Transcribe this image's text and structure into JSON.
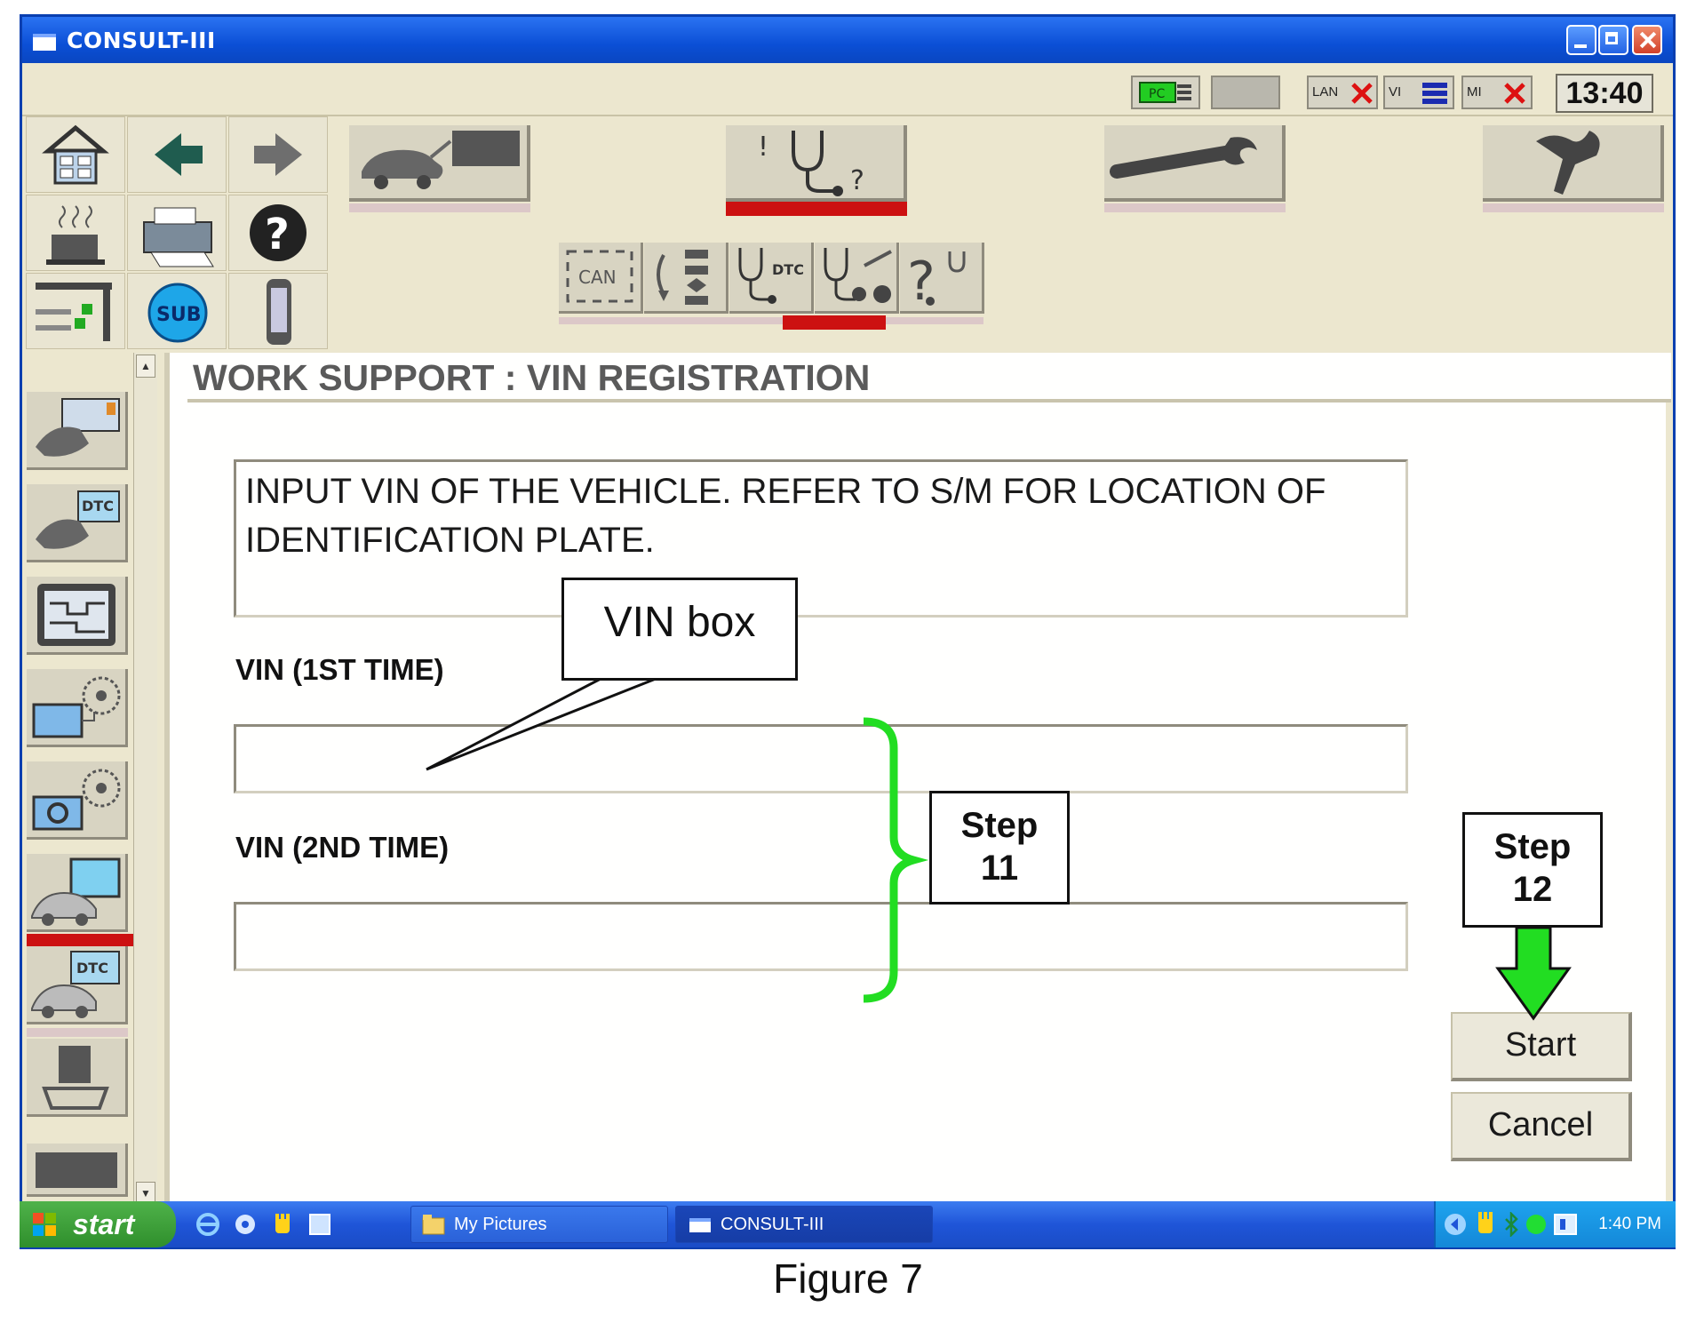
{
  "window": {
    "title": "CONSULT-III"
  },
  "status_bar": {
    "indicators": [
      {
        "name": "pc-indicator",
        "label": "PC"
      },
      {
        "name": "battery-indicator",
        "label": ""
      },
      {
        "name": "lan-indicator",
        "label": "LAN"
      },
      {
        "name": "vi-indicator",
        "label": "VI"
      },
      {
        "name": "mi-indicator",
        "label": "MI"
      }
    ],
    "clock": "13:40"
  },
  "toolbar": {
    "sub_badge": "SUB",
    "can_label": "CAN",
    "dtc_label": "DTC"
  },
  "sidebar": {
    "dtc_label_1": "DTC",
    "dtc_label_2": "DTC"
  },
  "main": {
    "screen_title": "WORK SUPPORT : VIN REGISTRATION",
    "instruction": "INPUT VIN OF THE VEHICLE. REFER TO S/M FOR LOCATION OF IDENTIFICATION PLATE.",
    "vin_first_label": "VIN (1ST TIME)",
    "vin_first_value": "",
    "vin_second_label": "VIN (2ND TIME)",
    "vin_second_value": "",
    "start_label": "Start",
    "cancel_label": "Cancel"
  },
  "annotations": {
    "vin_box": "VIN box",
    "step11_line1": "Step",
    "step11_line2": "11",
    "step12_line1": "Step",
    "step12_line2": "12"
  },
  "taskbar": {
    "start_label": "start",
    "items": [
      "My Pictures",
      "CONSULT-III"
    ],
    "tray_time": "1:40 PM"
  },
  "caption": "Figure 7",
  "colors": {
    "window_bg": "#ece7cf",
    "titlebar_blue": "#0b4fd6",
    "selected_red": "#cc1111",
    "callout_green": "#22dd22",
    "taskbar_blue": "#1f55d8"
  }
}
